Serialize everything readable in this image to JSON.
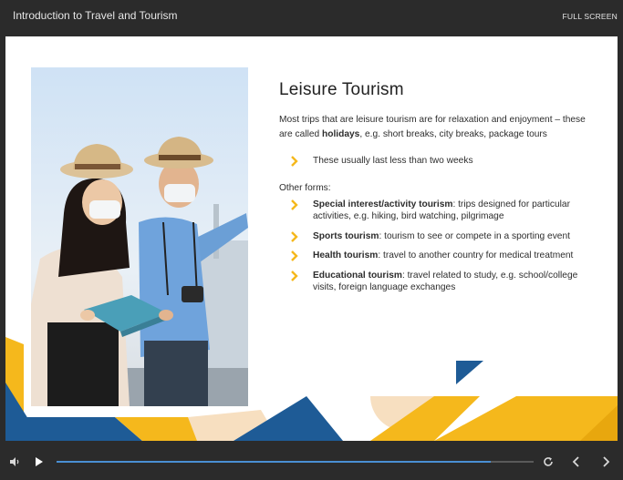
{
  "player": {
    "course_title": "Introduction to Travel and Tourism",
    "fullscreen_label": "FULL SCREEN",
    "progress": 0.91
  },
  "slide": {
    "heading": "Leisure Tourism",
    "intro": {
      "before": "Most trips that are leisure tourism are for relaxation and enjoyment – these are called ",
      "bold": "holidays",
      "after": ", e.g. short breaks, city breaks, package tours"
    },
    "main_bullet": "These usually last less than two weeks",
    "other_label": "Other forms:",
    "forms": [
      {
        "term": "Special interest/activity tourism",
        "text": ": trips designed for particular activities, e.g. hiking, bird watching, pilgrimage"
      },
      {
        "term": "Sports tourism",
        "text": ": tourism to see or compete in a sporting event"
      },
      {
        "term": "Health tourism",
        "text": ": travel to another country for medical treatment"
      },
      {
        "term": "Educational tourism",
        "text": ": travel related to study, e.g. school/college visits, foreign language exchanges"
      }
    ]
  },
  "colors": {
    "accent_yellow": "#f5b81c",
    "accent_blue": "#1e5b96",
    "peach": "#f7dfc0",
    "progress": "#4a8fd4"
  }
}
